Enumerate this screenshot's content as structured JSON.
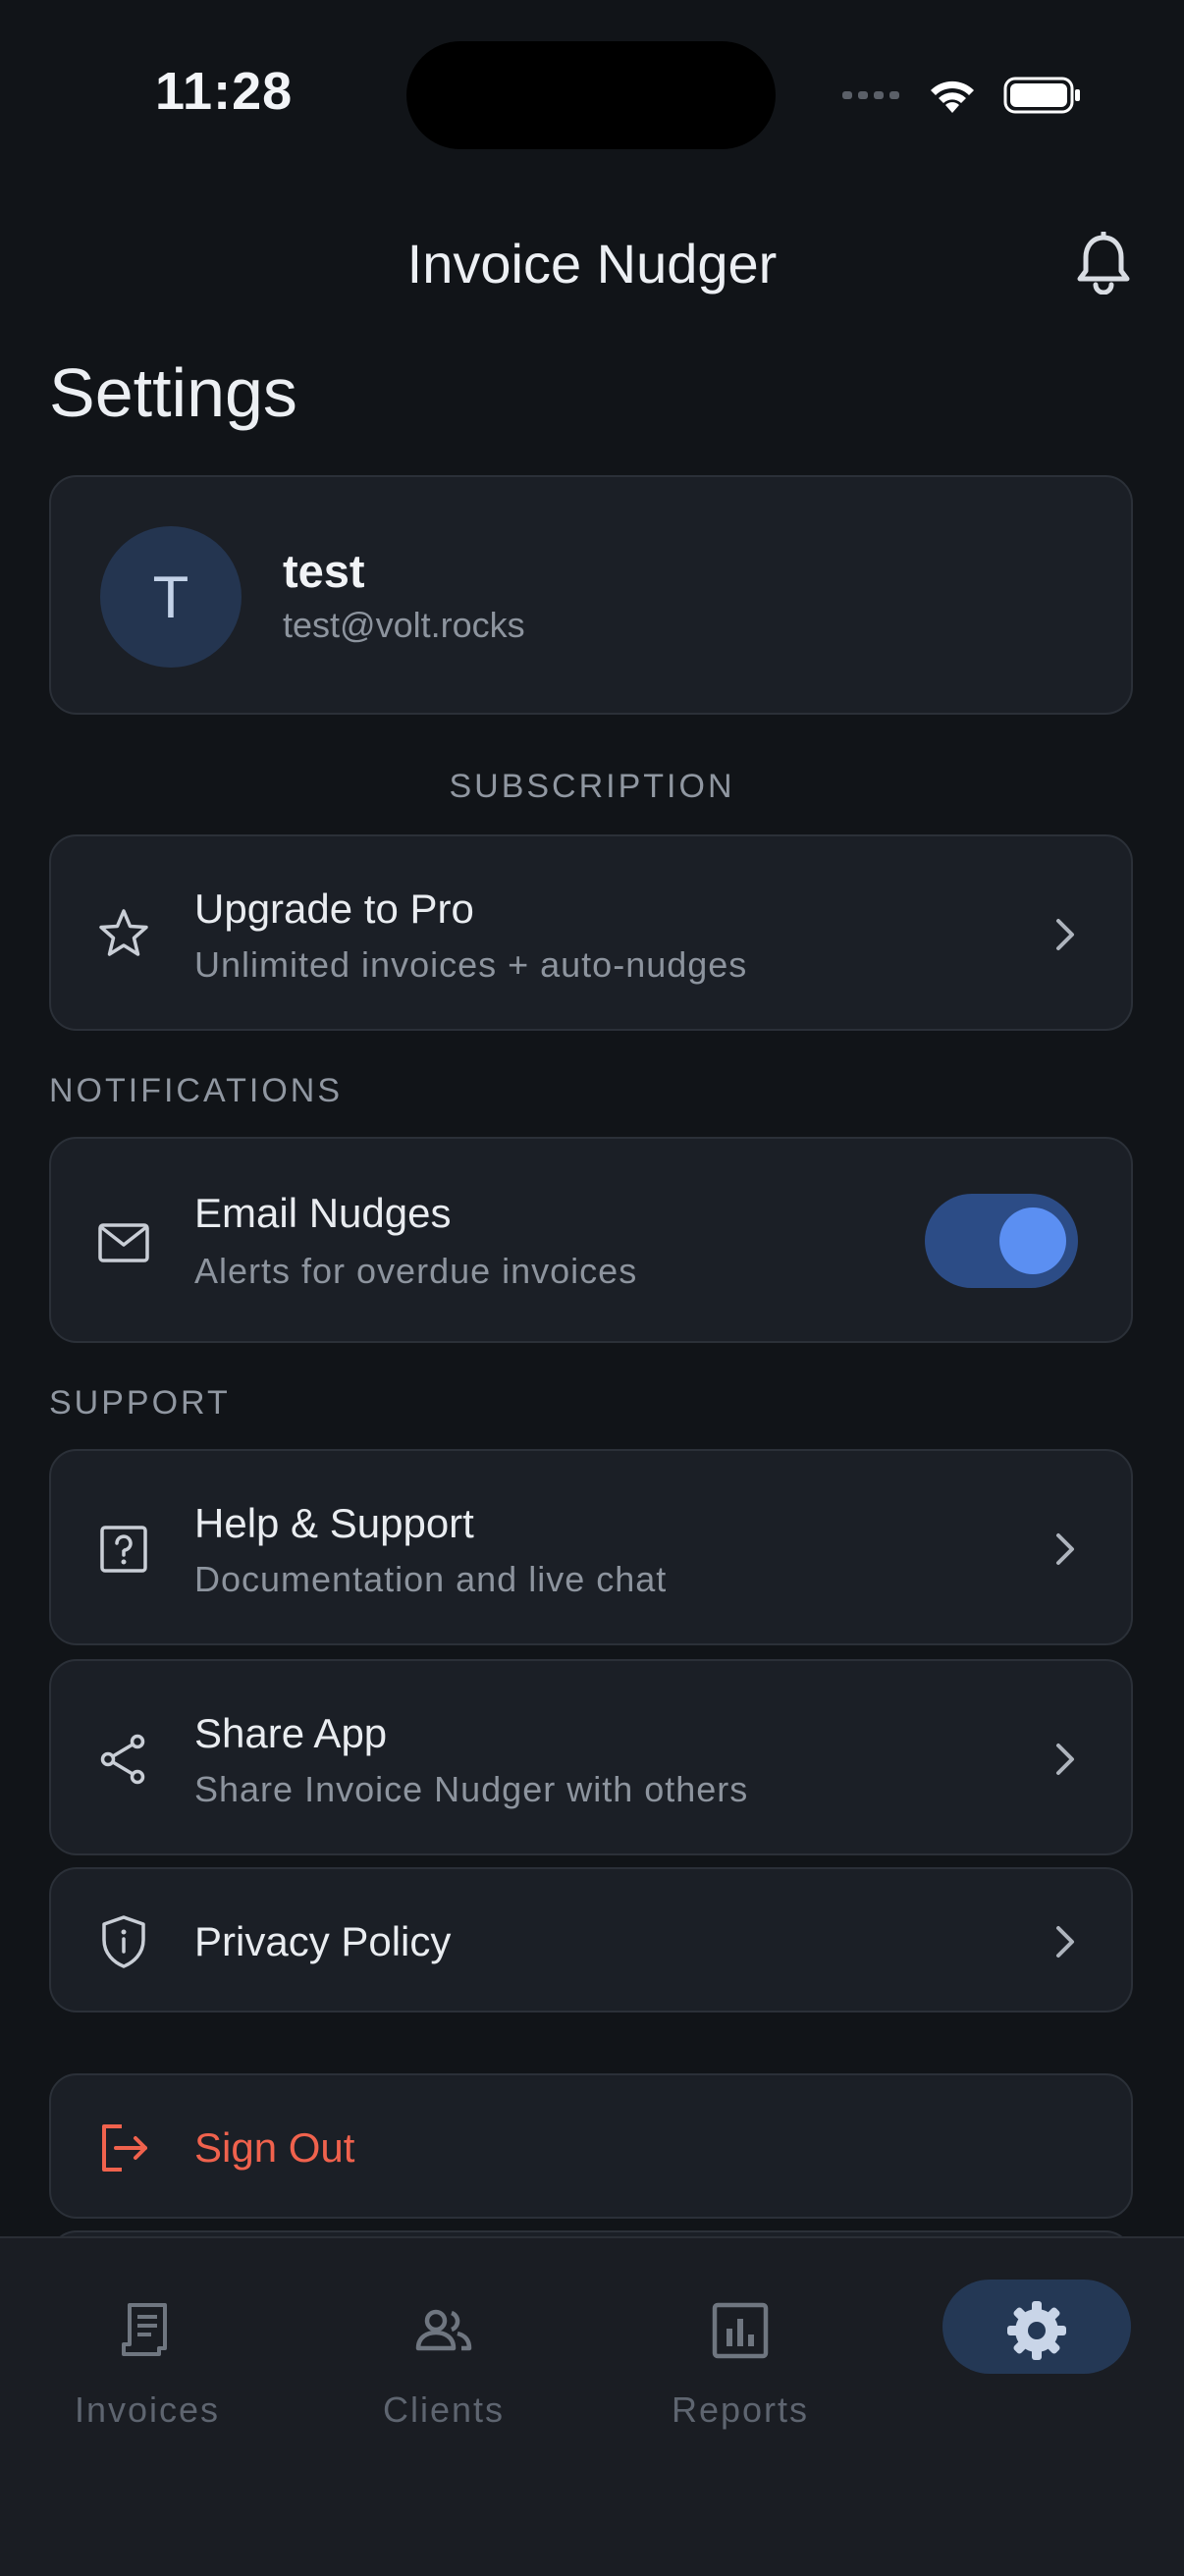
{
  "status_bar": {
    "time": "11:28"
  },
  "header": {
    "app_title": "Invoice Nudger",
    "bell_icon": "bell-icon"
  },
  "page_title": "Settings",
  "profile": {
    "initial": "T",
    "name": "test",
    "email": "test@volt.rocks"
  },
  "sections": {
    "subscription": "SUBSCRIPTION",
    "notifications": "NOTIFICATIONS",
    "support": "SUPPORT"
  },
  "upgrade": {
    "title": "Upgrade to Pro",
    "subtitle": "Unlimited invoices + auto-nudges",
    "icon": "star-icon"
  },
  "email_nudges": {
    "title": "Email Nudges",
    "subtitle": "Alerts for overdue invoices",
    "enabled": true,
    "icon": "mail-icon"
  },
  "help": {
    "title": "Help & Support",
    "subtitle": "Documentation and live chat",
    "icon": "help-icon"
  },
  "share": {
    "title": "Share App",
    "subtitle": "Share Invoice Nudger with others",
    "icon": "share-icon"
  },
  "privacy": {
    "title": "Privacy Policy",
    "icon": "shield-icon"
  },
  "sign_out": {
    "label": "Sign Out",
    "color": "#F0624D",
    "icon": "logout-icon"
  },
  "nav": {
    "items": [
      {
        "label": "Invoices",
        "icon": "receipt-icon"
      },
      {
        "label": "Clients",
        "icon": "people-icon"
      },
      {
        "label": "Reports",
        "icon": "chart-icon"
      },
      {
        "label": "",
        "icon": "gear-icon",
        "active": true
      }
    ]
  },
  "colors": {
    "background": "#111418",
    "card": "#1B1F26",
    "accent": "#5B8FF2",
    "danger": "#F0624D"
  }
}
